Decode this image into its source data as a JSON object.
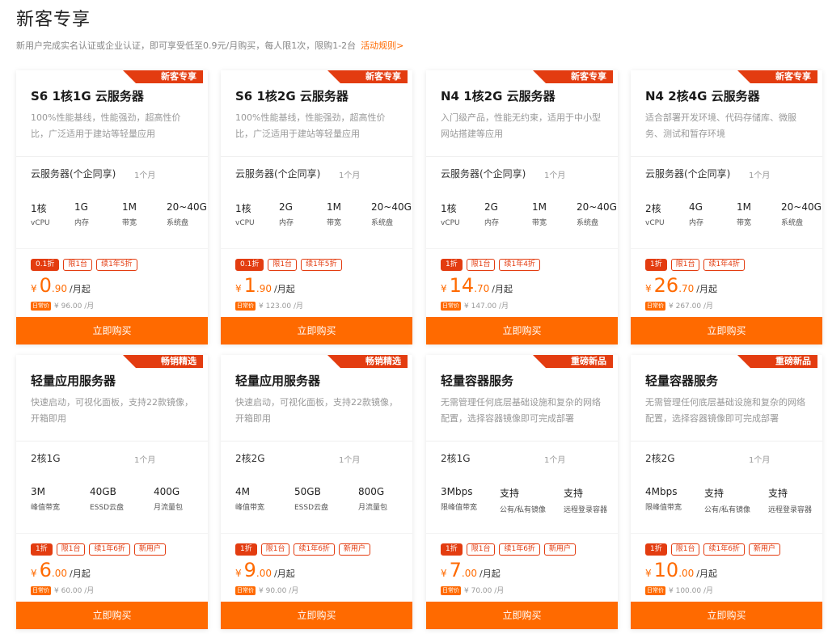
{
  "header": {
    "title": "新客专享",
    "desc": "新用户完成实名认证或企业认证，即可享受低至0.9元/月购买，每人限1次，限购1-2台",
    "rules_link": "活动规则>"
  },
  "colors": {
    "accent": "#ff6a00",
    "ribbon": "#e33c10"
  },
  "cards": [
    {
      "badge": "新客专享",
      "title": "S6 1核1G 云服务器",
      "desc": "100%性能基线，性能强劲，超高性价比，广泛适用于建站等轻量应用",
      "spec": "云服务器(个企同享)",
      "duration": "1个月",
      "cfg": [
        {
          "v": "1核",
          "l": "vCPU"
        },
        {
          "v": "1G",
          "l": "内存"
        },
        {
          "v": "1M",
          "l": "带宽"
        },
        {
          "v": "20~40G",
          "l": "系统盘"
        }
      ],
      "tags": [
        "0.1折",
        "限1台",
        "续1年5折"
      ],
      "price_int": "0",
      "price_dec": ".90",
      "unit": "/月起",
      "orig_badge": "日常价",
      "orig": "¥ 96.00 /月",
      "btn": "立即购买"
    },
    {
      "badge": "新客专享",
      "title": "S6 1核2G 云服务器",
      "desc": "100%性能基线，性能强劲，超高性价比，广泛适用于建站等轻量应用",
      "spec": "云服务器(个企同享)",
      "duration": "1个月",
      "cfg": [
        {
          "v": "1核",
          "l": "vCPU"
        },
        {
          "v": "2G",
          "l": "内存"
        },
        {
          "v": "1M",
          "l": "带宽"
        },
        {
          "v": "20~40G",
          "l": "系统盘"
        }
      ],
      "tags": [
        "0.1折",
        "限1台",
        "续1年5折"
      ],
      "price_int": "1",
      "price_dec": ".90",
      "unit": "/月起",
      "orig_badge": "日常价",
      "orig": "¥ 123.00 /月",
      "btn": "立即购买"
    },
    {
      "badge": "新客专享",
      "title": "N4 1核2G 云服务器",
      "desc": "入门级产品，性能无约束，适用于中小型网站搭建等应用",
      "spec": "云服务器(个企同享)",
      "duration": "1个月",
      "cfg": [
        {
          "v": "1核",
          "l": "vCPU"
        },
        {
          "v": "2G",
          "l": "内存"
        },
        {
          "v": "1M",
          "l": "带宽"
        },
        {
          "v": "20~40G",
          "l": "系统盘"
        }
      ],
      "tags": [
        "1折",
        "限1台",
        "续1年4折"
      ],
      "price_int": "14",
      "price_dec": ".70",
      "unit": "/月起",
      "orig_badge": "日常价",
      "orig": "¥ 147.00 /月",
      "btn": "立即购买"
    },
    {
      "badge": "新客专享",
      "title": "N4 2核4G 云服务器",
      "desc": "适合部署开发环境、代码存储库、微服务、测试和暂存环境",
      "spec": "云服务器(个企同享)",
      "duration": "1个月",
      "cfg": [
        {
          "v": "2核",
          "l": "vCPU"
        },
        {
          "v": "4G",
          "l": "内存"
        },
        {
          "v": "1M",
          "l": "带宽"
        },
        {
          "v": "20~40G",
          "l": "系统盘"
        }
      ],
      "tags": [
        "1折",
        "限1台",
        "续1年4折"
      ],
      "price_int": "26",
      "price_dec": ".70",
      "unit": "/月起",
      "orig_badge": "日常价",
      "orig": "¥ 267.00 /月",
      "btn": "立即购买"
    },
    {
      "badge": "畅销精选",
      "title": "轻量应用服务器",
      "desc": "快速启动，可视化面板，支持22款镜像，开箱即用",
      "spec": "2核1G",
      "duration": "1个月",
      "cfg": [
        {
          "v": "3M",
          "l": "峰值带宽"
        },
        {
          "v": "40GB",
          "l": "ESSD云盘"
        },
        {
          "v": "400G",
          "l": "月流量包"
        }
      ],
      "tags": [
        "1折",
        "限1台",
        "续1年6折",
        "新用户"
      ],
      "price_int": "6",
      "price_dec": ".00",
      "unit": "/月起",
      "orig_badge": "日常价",
      "orig": "¥ 60.00 /月",
      "btn": "立即购买"
    },
    {
      "badge": "畅销精选",
      "title": "轻量应用服务器",
      "desc": "快速启动，可视化面板，支持22款镜像，开箱即用",
      "spec": "2核2G",
      "duration": "1个月",
      "cfg": [
        {
          "v": "4M",
          "l": "峰值带宽"
        },
        {
          "v": "50GB",
          "l": "ESSD云盘"
        },
        {
          "v": "800G",
          "l": "月流量包"
        }
      ],
      "tags": [
        "1折",
        "限1台",
        "续1年6折",
        "新用户"
      ],
      "price_int": "9",
      "price_dec": ".00",
      "unit": "/月起",
      "orig_badge": "日常价",
      "orig": "¥ 90.00 /月",
      "btn": "立即购买"
    },
    {
      "badge": "重磅新品",
      "title": "轻量容器服务",
      "desc": "无需管理任何底层基础设施和复杂的网络配置，选择容器镜像即可完成部署",
      "spec": "2核1G",
      "duration": "1个月",
      "cfg": [
        {
          "v": "3Mbps",
          "l": "限峰值带宽"
        },
        {
          "v": "支持",
          "l": "公有/私有镜像"
        },
        {
          "v": "支持",
          "l": "远程登录容器"
        }
      ],
      "tags": [
        "1折",
        "限1台",
        "续1年6折",
        "新用户"
      ],
      "price_int": "7",
      "price_dec": ".00",
      "unit": "/月起",
      "orig_badge": "日常价",
      "orig": "¥ 70.00 /月",
      "btn": "立即购买"
    },
    {
      "badge": "重磅新品",
      "title": "轻量容器服务",
      "desc": "无需管理任何底层基础设施和复杂的网络配置，选择容器镜像即可完成部署",
      "spec": "2核2G",
      "duration": "1个月",
      "cfg": [
        {
          "v": "4Mbps",
          "l": "限峰值带宽"
        },
        {
          "v": "支持",
          "l": "公有/私有镜像"
        },
        {
          "v": "支持",
          "l": "远程登录容器"
        }
      ],
      "tags": [
        "1折",
        "限1台",
        "续1年6折",
        "新用户"
      ],
      "price_int": "10",
      "price_dec": ".00",
      "unit": "/月起",
      "orig_badge": "日常价",
      "orig": "¥ 100.00 /月",
      "btn": "立即购买"
    }
  ]
}
